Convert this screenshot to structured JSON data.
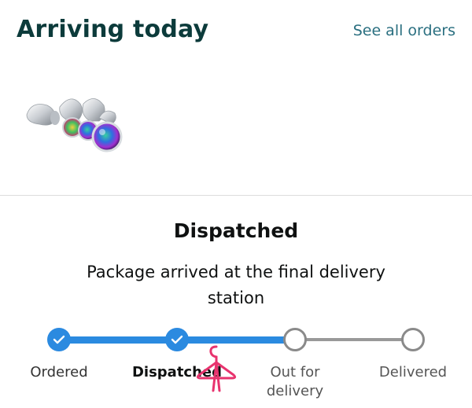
{
  "header": {
    "title": "Arriving today",
    "see_all_label": "See all orders"
  },
  "product": {
    "image_description_icon": "jewelry-product-icon"
  },
  "status": {
    "heading": "Dispatched",
    "description": "Package arrived at the final delivery station"
  },
  "tracker": {
    "progress_fraction": 0.67,
    "steps": [
      {
        "label": "Ordered",
        "state": "done"
      },
      {
        "label": "Dispatched",
        "state": "done"
      },
      {
        "label": "Out for delivery",
        "state": "pending"
      },
      {
        "label": "Delivered",
        "state": "pending"
      }
    ]
  },
  "colors": {
    "title": "#0c3b3b",
    "link": "#2a6f80",
    "progress": "#2b8ae0",
    "pending": "#8a8a8a",
    "overlay": "#e8336e"
  }
}
